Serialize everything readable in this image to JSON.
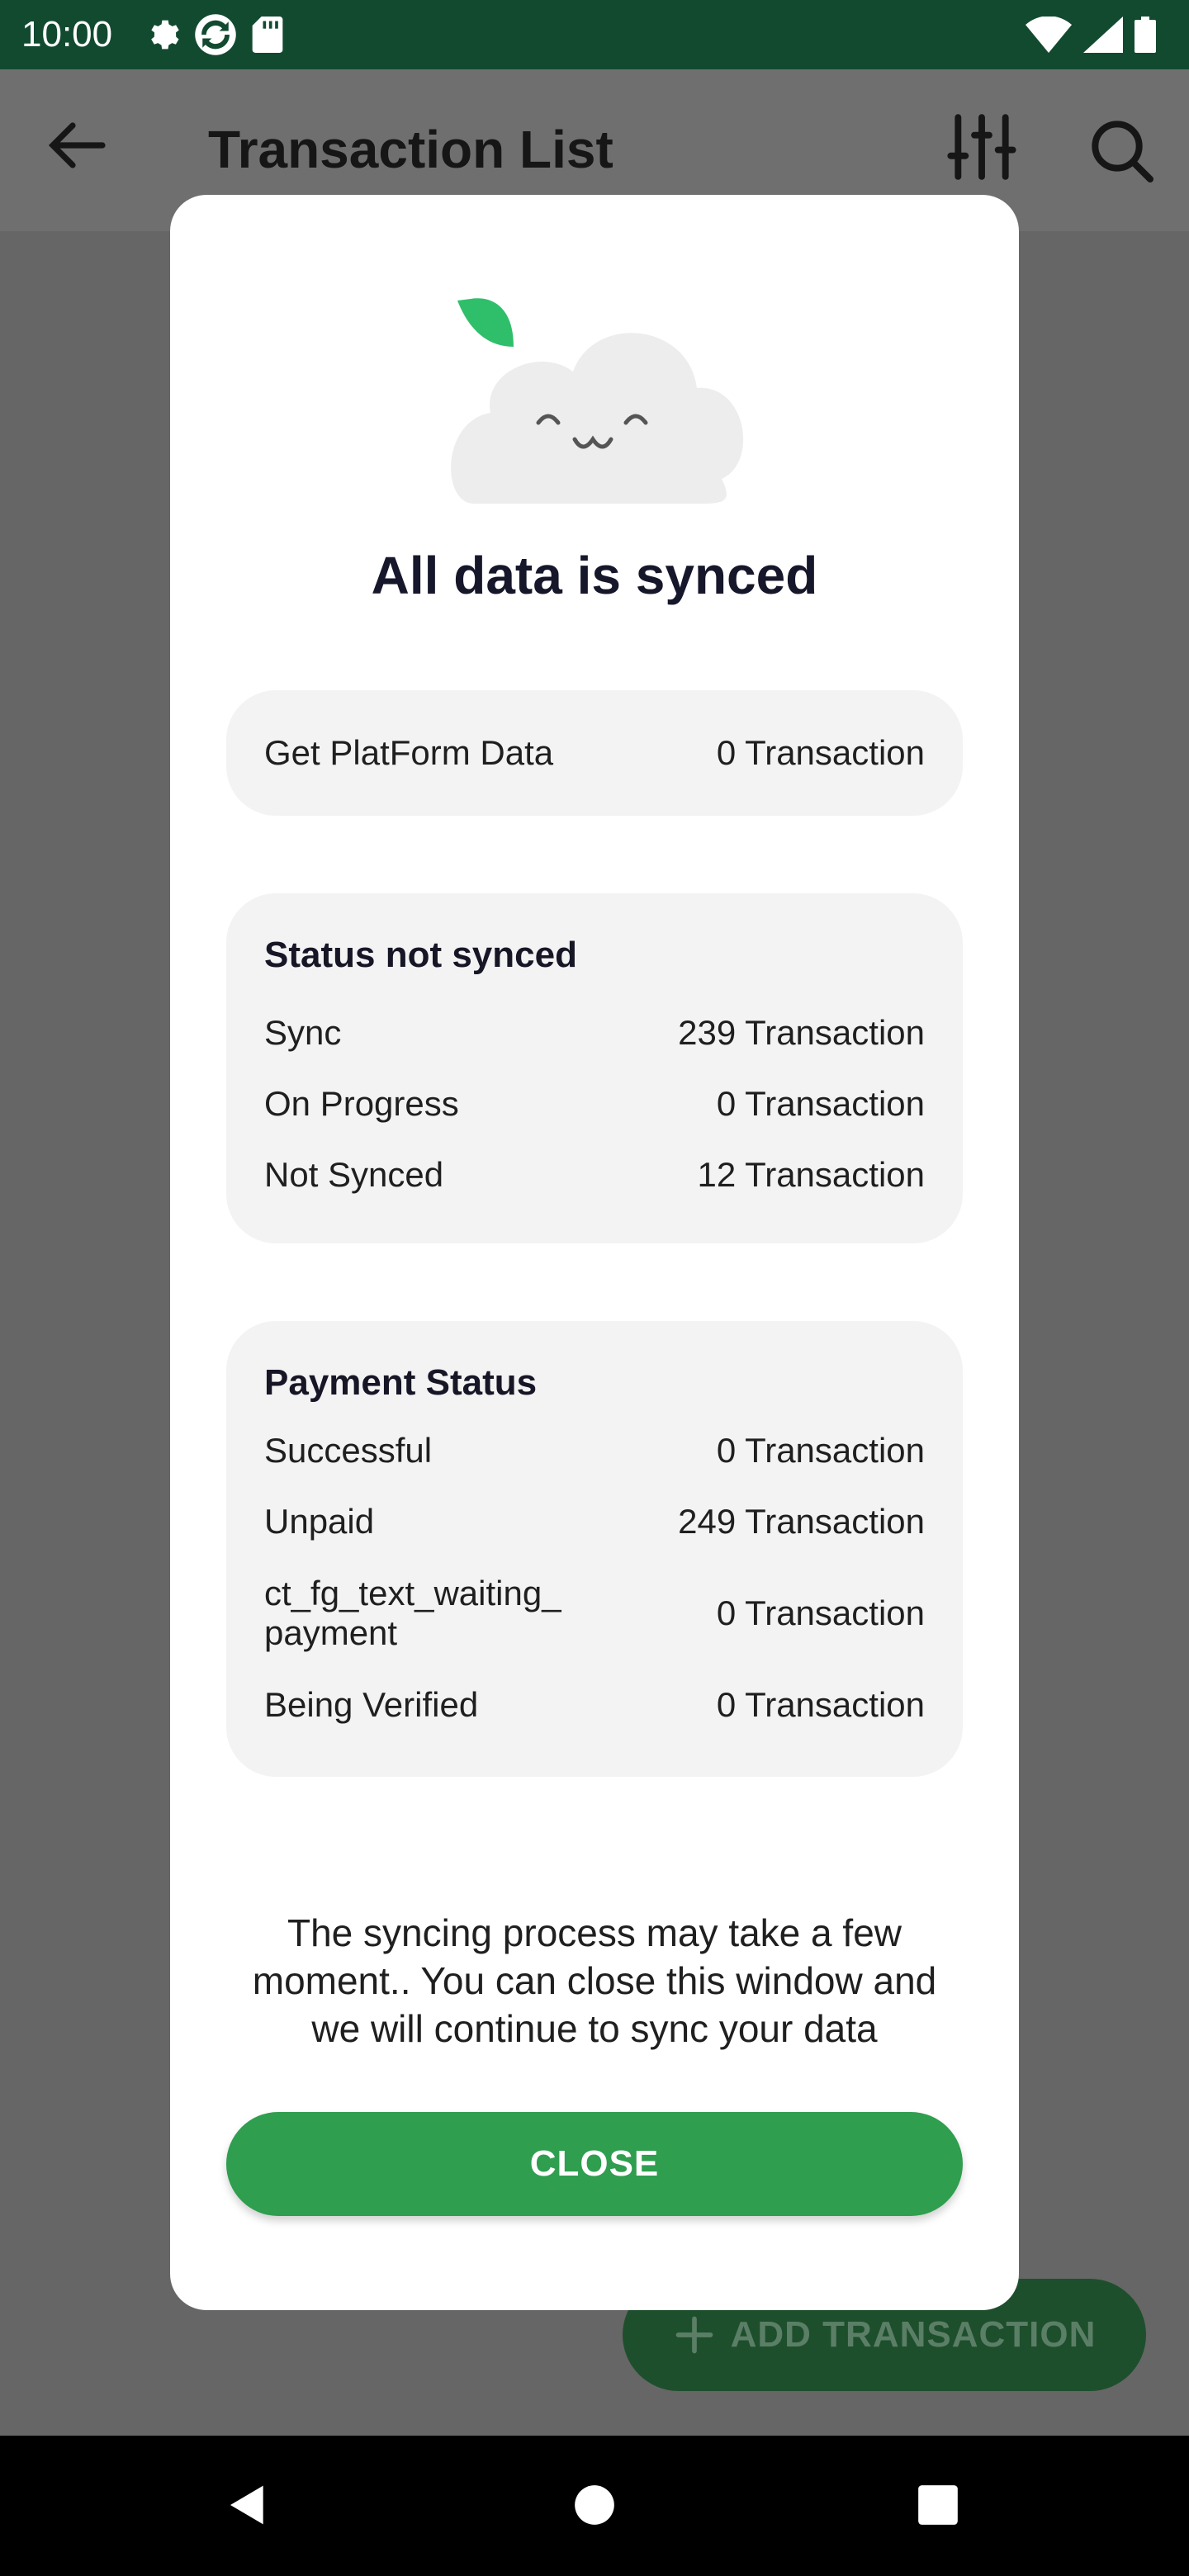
{
  "status_bar": {
    "time": "10:00"
  },
  "app_bar": {
    "title": "Transaction List"
  },
  "fab": {
    "label": "ADD TRANSACTION"
  },
  "dialog": {
    "title": "All data is synced",
    "platform": {
      "label": "Get PlatForm Data",
      "value": "0 Transaction"
    },
    "sync_status": {
      "title": "Status not synced",
      "rows": [
        {
          "label": "Sync",
          "value": "239 Transaction"
        },
        {
          "label": "On Progress",
          "value": "0 Transaction"
        },
        {
          "label": "Not Synced",
          "value": "12 Transaction"
        }
      ]
    },
    "payment_status": {
      "title": "Payment Status",
      "rows": [
        {
          "label": "Successful",
          "value": "0 Transaction"
        },
        {
          "label": "Unpaid",
          "value": "249 Transaction"
        },
        {
          "label": "ct_fg_text_waiting_ payment",
          "value": "0 Transaction"
        },
        {
          "label": "Being Verified",
          "value": "0 Transaction"
        }
      ]
    },
    "info": "The syncing process may take a few moment.. You can close this window and we will continue to sync your data",
    "close_label": "CLOSE"
  },
  "colors": {
    "status_bar": "#124a30",
    "primary_green": "#2f9e4f",
    "leaf_green": "#2fbf6a",
    "dialog_bg": "#ffffff",
    "card_bg": "#f3f3f3"
  },
  "icons": [
    "settings-icon",
    "sync-icon",
    "sd-card-icon",
    "wifi-icon",
    "signal-icon",
    "battery-icon",
    "back-arrow-icon",
    "filter-icon",
    "search-icon",
    "plus-icon",
    "nav-back-icon",
    "nav-home-icon",
    "nav-recents-icon"
  ]
}
